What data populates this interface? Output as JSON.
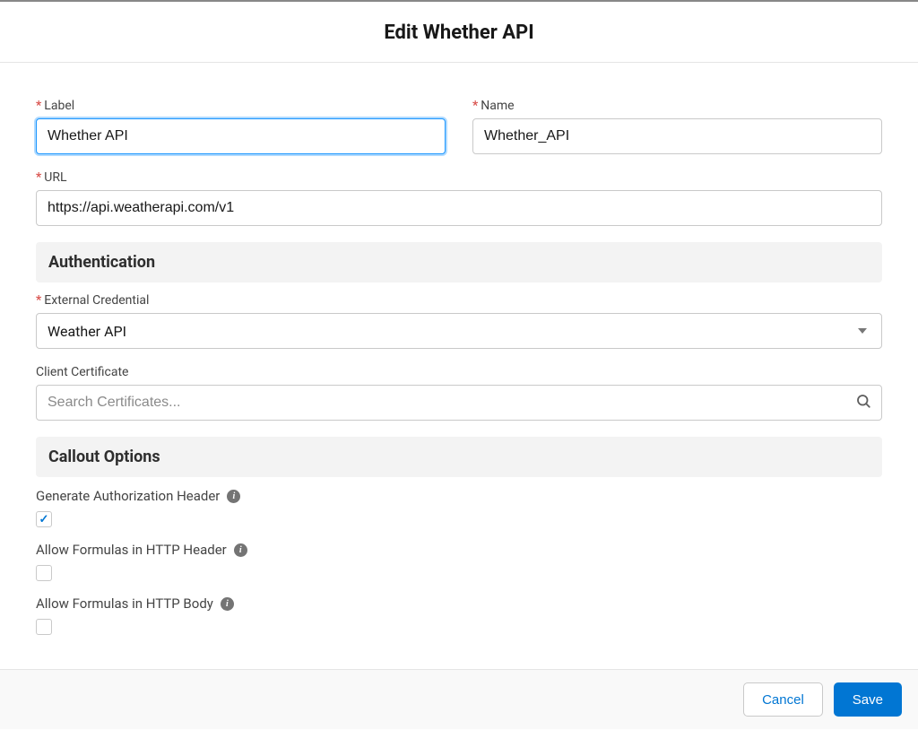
{
  "header": {
    "title": "Edit Whether API"
  },
  "fields": {
    "label": {
      "label": "Label",
      "value": "Whether API"
    },
    "name": {
      "label": "Name",
      "value": "Whether_API"
    },
    "url": {
      "label": "URL",
      "value": "https://api.weatherapi.com/v1"
    },
    "external_credential": {
      "label": "External Credential",
      "value": "Weather API"
    },
    "client_certificate": {
      "label": "Client Certificate",
      "placeholder": "Search Certificates..."
    }
  },
  "sections": {
    "authentication": "Authentication",
    "callout_options": "Callout Options"
  },
  "options": {
    "gen_auth_header": {
      "label": "Generate Authorization Header",
      "checked": true
    },
    "allow_formulas_header": {
      "label": "Allow Formulas in HTTP Header",
      "checked": false
    },
    "allow_formulas_body": {
      "label": "Allow Formulas in HTTP Body",
      "checked": false
    }
  },
  "buttons": {
    "cancel": "Cancel",
    "save": "Save"
  }
}
